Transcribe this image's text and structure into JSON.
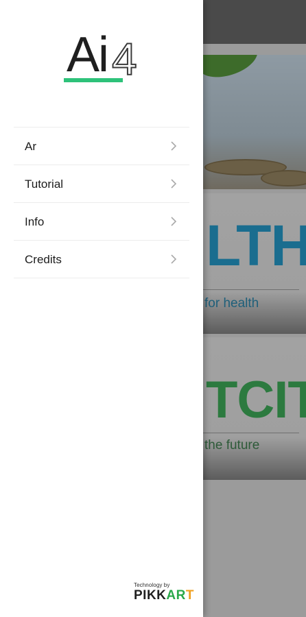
{
  "colors": {
    "drawer_bg": "#ffffff",
    "logo_accent": "#2ec27a",
    "divider": "#ececec",
    "scrim_overlay": "#9b9b9b",
    "health_text": "#1a6d8f",
    "city_text": "#2c7a3f"
  },
  "drawer": {
    "logo": {
      "main": "Ai",
      "number": "4"
    },
    "menu": [
      {
        "label": "Ar",
        "icon": "chevron-right-icon"
      },
      {
        "label": "Tutorial",
        "icon": "chevron-right-icon"
      },
      {
        "label": "Info",
        "icon": "chevron-right-icon"
      },
      {
        "label": "Credits",
        "icon": "chevron-right-icon"
      }
    ],
    "credit": {
      "caption": "Technology by",
      "brand_part1": "PIKK",
      "brand_part2": "AR",
      "brand_part3": "T"
    }
  },
  "background": {
    "cards": [
      {
        "headline": "LTH",
        "tagline": "for health"
      },
      {
        "headline": "TCITY",
        "tagline": "the future"
      }
    ]
  }
}
